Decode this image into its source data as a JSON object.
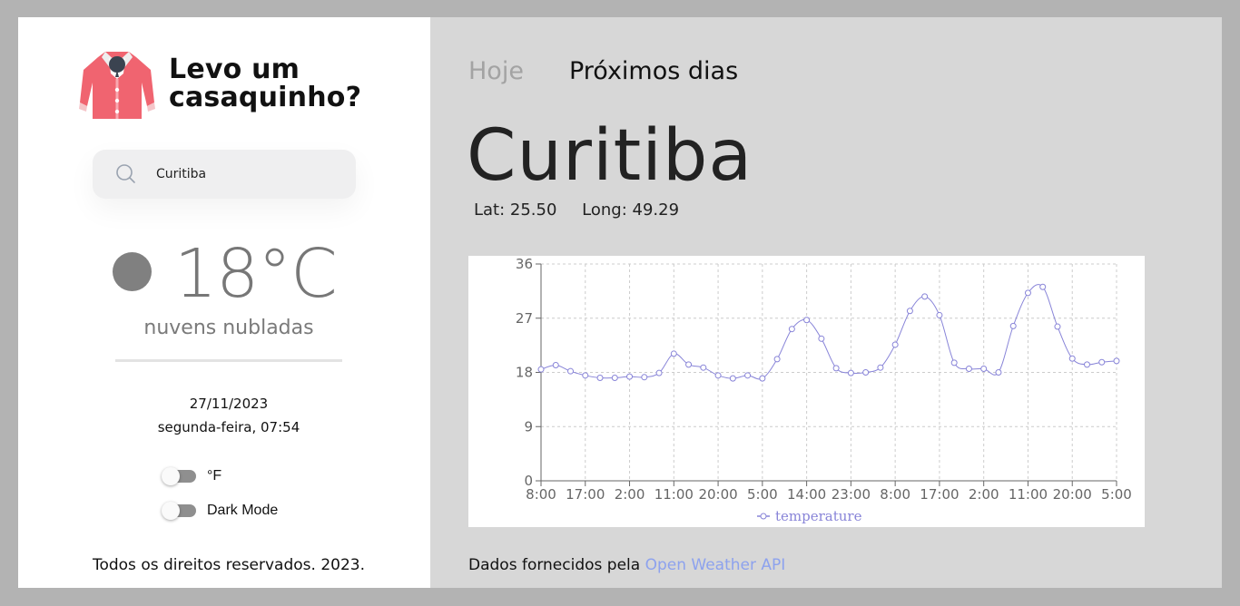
{
  "app": {
    "title_line1": "Levo um",
    "title_line2": "casaquinho?"
  },
  "search": {
    "value": "Curitiba",
    "placeholder": ""
  },
  "current": {
    "temperature": "18°C",
    "description": "nuvens nubladas",
    "date": "27/11/2023",
    "weekday_time": "segunda-feira, 07:54"
  },
  "settings": {
    "unit_label": "°F",
    "unit_on": false,
    "dark_label": "Dark Mode",
    "dark_on": false
  },
  "footer": {
    "rights": "Todos os direitos reservados. 2023.",
    "credit_prefix": "Dados fornecidos pela",
    "credit_link": "Open Weather API"
  },
  "tabs": [
    {
      "label": "Hoje",
      "active": false
    },
    {
      "label": "Próximos dias",
      "active": true
    }
  ],
  "location": {
    "city": "Curitiba",
    "lat": "Lat: 25.50",
    "long": "Long: 49.29"
  },
  "colors": {
    "series": "#8884d8",
    "link": "#8da2ee",
    "icon": "#808080"
  },
  "chart_data": {
    "type": "line",
    "x_ticks": [
      "8:00",
      "17:00",
      "2:00",
      "11:00",
      "20:00",
      "5:00",
      "14:00",
      "23:00",
      "8:00",
      "17:00",
      "2:00",
      "11:00",
      "20:00",
      "5:00"
    ],
    "yticks": [
      0,
      9,
      18,
      27,
      36
    ],
    "ylim": [
      0,
      36
    ],
    "grid": true,
    "legend": "bottom-center",
    "series": [
      {
        "name": "temperature",
        "values": [
          18.5,
          19.2,
          18.2,
          17.5,
          17.1,
          17.1,
          17.3,
          17.2,
          17.9,
          21.1,
          19.3,
          18.8,
          17.5,
          17.0,
          17.5,
          17.0,
          20.2,
          25.2,
          26.7,
          23.6,
          18.7,
          17.9,
          18.0,
          18.8,
          22.6,
          28.2,
          30.6,
          27.5,
          19.6,
          18.6,
          18.6,
          18.0,
          25.7,
          31.2,
          32.2,
          25.6,
          20.3,
          19.3,
          19.7,
          19.9
        ]
      }
    ]
  }
}
